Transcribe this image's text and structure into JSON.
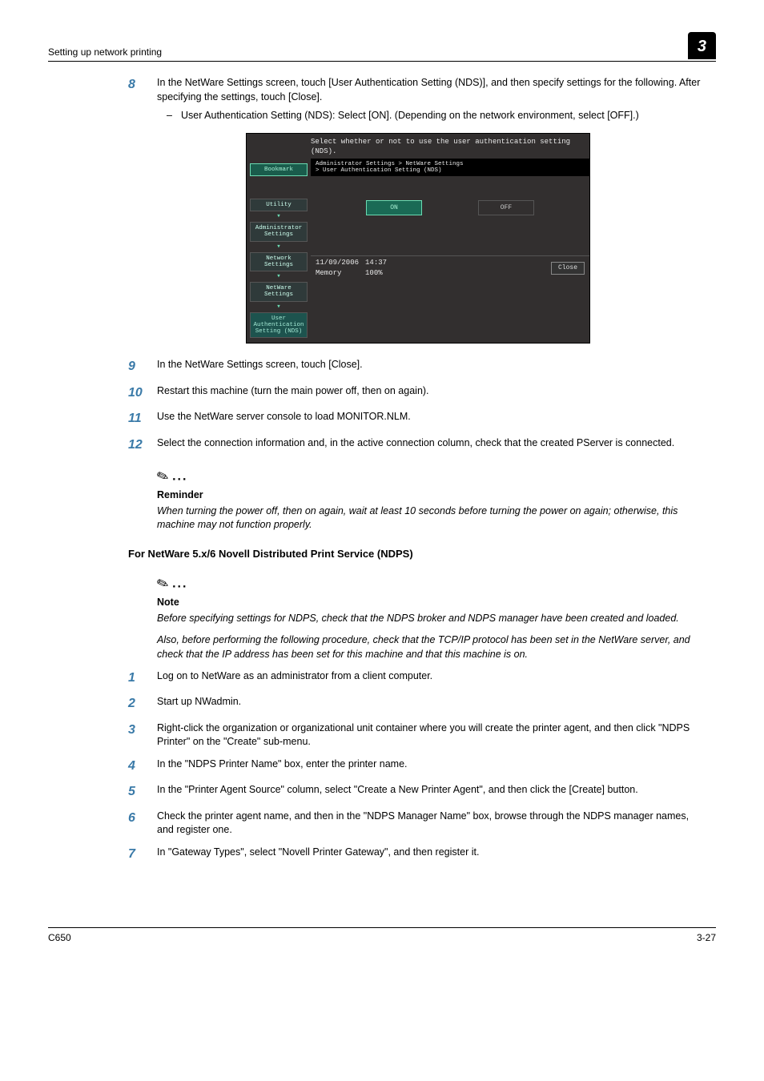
{
  "header": {
    "left": "Setting up network printing",
    "chapter": "3"
  },
  "steps_a": [
    {
      "n": "8",
      "body": "In the NetWare Settings screen, touch [User Authentication Setting (NDS)], and then specify settings for the following. After specifying the settings, touch [Close].",
      "sub": "User Authentication Setting (NDS): Select [ON]. (Depending on the network environment, select [OFF].)"
    },
    {
      "n": "9",
      "body": "In the NetWare Settings screen, touch [Close]."
    },
    {
      "n": "10",
      "body": "Restart this machine (turn the main power off, then on again)."
    },
    {
      "n": "11",
      "body": "Use the NetWare server console to load MONITOR.NLM."
    },
    {
      "n": "12",
      "body": "Select the connection information and, in the active connection column, check that the created PServer is connected."
    }
  ],
  "panel": {
    "top": "Select whether or not to use the user authentication setting (NDS).",
    "breadcrumb": "Administrator Settings > NetWare Settings\n> User Authentication Setting (NDS)",
    "buttons": {
      "bookmark": "Bookmark",
      "utility": "Utility",
      "admin": "Administrator\nSettings",
      "network": "Network\nSettings",
      "netware": "NetWare\nSettings",
      "userauth": "User\nAuthentication\nSetting (NDS)"
    },
    "on": "ON",
    "off": "OFF",
    "date": "11/09/2006",
    "time": "14:37",
    "mem_label": "Memory",
    "mem_val": "100%",
    "close": "Close"
  },
  "reminder": {
    "title": "Reminder",
    "body": "When turning the power off, then on again, wait at least 10 seconds before turning the power on again; otherwise, this machine may not function properly."
  },
  "subhead": "For NetWare 5.x/6 Novell Distributed Print Service (NDPS)",
  "note": {
    "title": "Note",
    "p1": "Before specifying settings for NDPS, check that the NDPS broker and NDPS manager have been created and loaded.",
    "p2": "Also, before performing the following procedure, check that the TCP/IP protocol has been set in the NetWare server, and check that the IP address has been set for this machine and that this machine is on."
  },
  "steps_b": [
    {
      "n": "1",
      "body": "Log on to NetWare as an administrator from a client computer."
    },
    {
      "n": "2",
      "body": "Start up NWadmin."
    },
    {
      "n": "3",
      "body": "Right-click the organization or organizational unit container where you will create the printer agent, and then click \"NDPS Printer\" on the \"Create\" sub-menu."
    },
    {
      "n": "4",
      "body": "In the \"NDPS Printer Name\" box, enter the printer name."
    },
    {
      "n": "5",
      "body": "In the \"Printer Agent Source\" column, select \"Create a New Printer Agent\", and then click the [Create] button."
    },
    {
      "n": "6",
      "body": "Check the printer agent name, and then in the \"NDPS Manager Name\" box, browse through the NDPS manager names, and register one."
    },
    {
      "n": "7",
      "body": "In \"Gateway Types\", select \"Novell Printer Gateway\", and then register it."
    }
  ],
  "footer": {
    "left": "C650",
    "right": "3-27"
  }
}
